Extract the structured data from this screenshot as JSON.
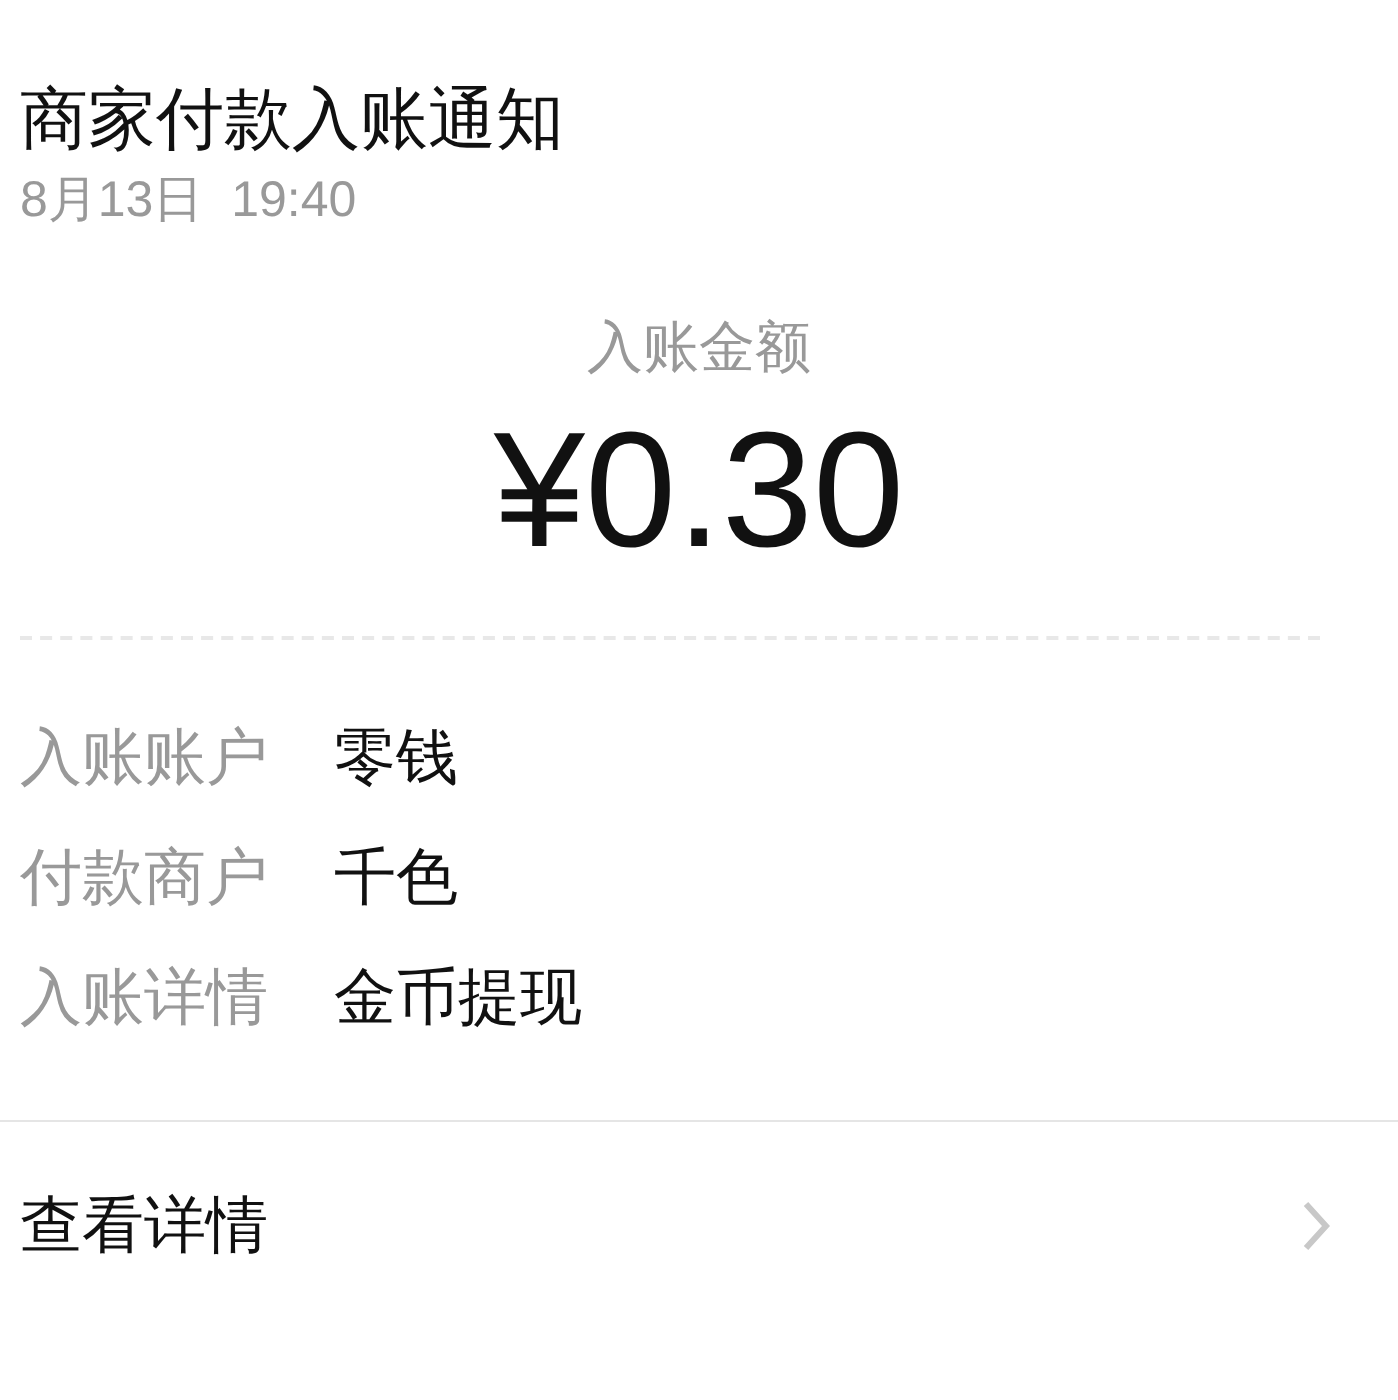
{
  "title": "商家付款入账通知",
  "time": "8月13日  19:40",
  "amount_label": "入账金额",
  "amount": "¥0.30",
  "details": [
    {
      "label": "入账账户",
      "value": "零钱"
    },
    {
      "label": "付款商户",
      "value": "千色"
    },
    {
      "label": "入账详情",
      "value": "金币提现"
    }
  ],
  "link": "查看详情"
}
